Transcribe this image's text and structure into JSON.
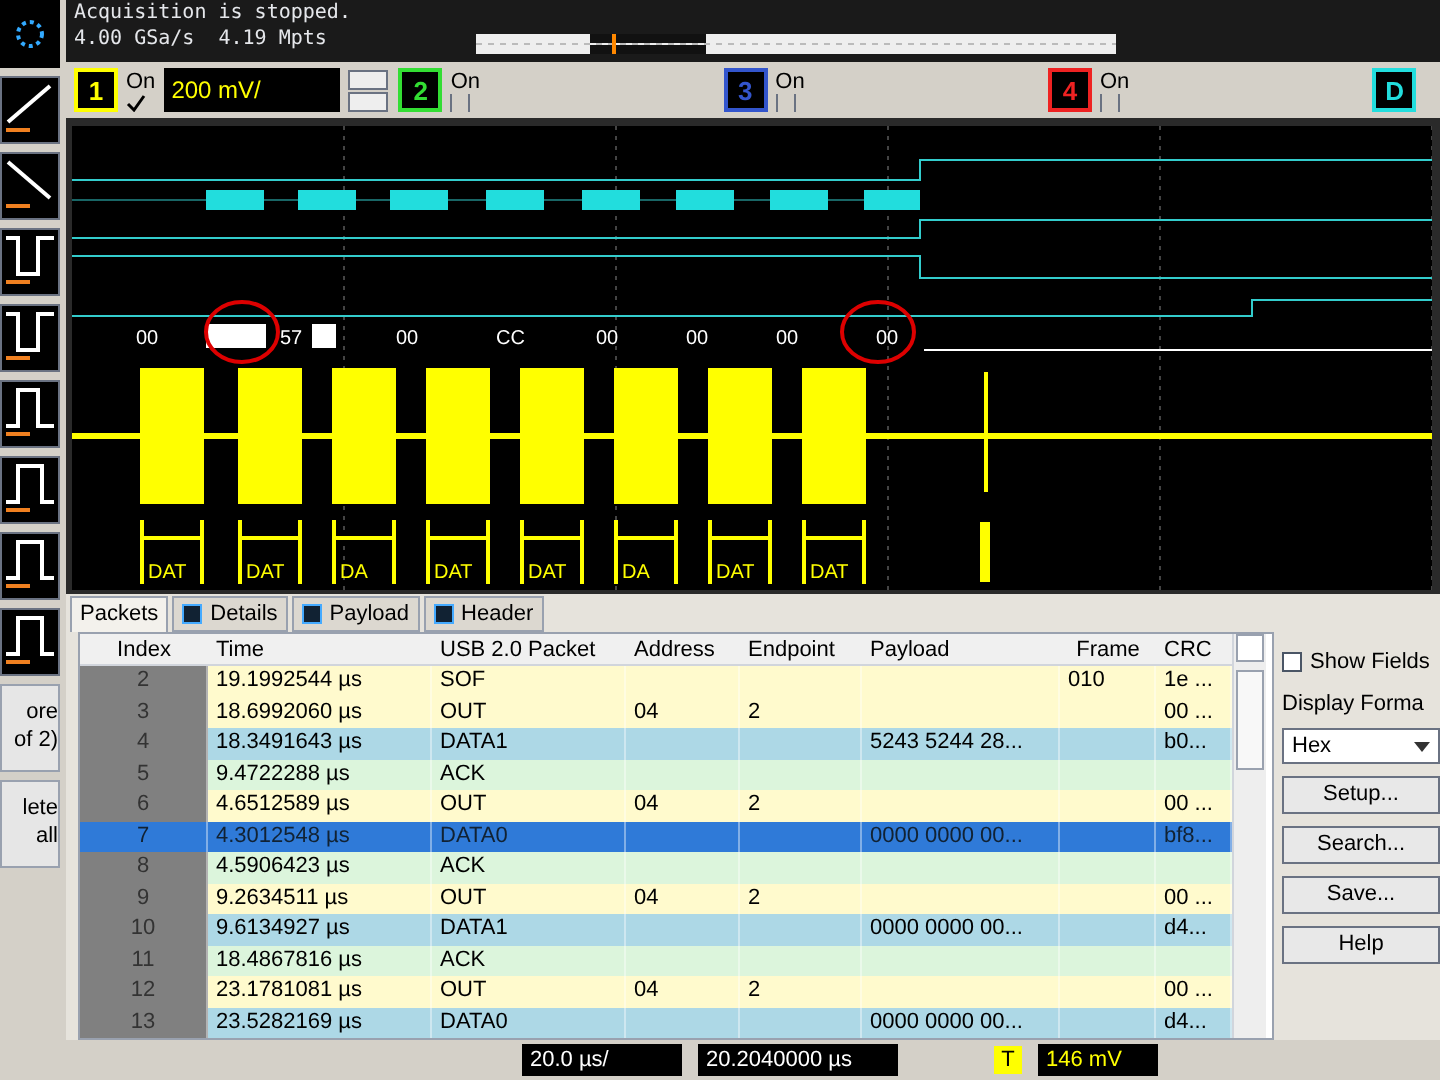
{
  "status": {
    "message": "Acquisition is stopped.",
    "rate": "4.00 GSa/s",
    "points": "4.19 Mpts"
  },
  "channels": [
    {
      "label": "1",
      "color": "#ffff00",
      "state_label": "On",
      "on": true,
      "scale": "200 mV/"
    },
    {
      "label": "2",
      "color": "#33dd33",
      "state_label": "On",
      "on": false
    },
    {
      "label": "3",
      "color": "#3355cc",
      "state_label": "On",
      "on": false
    },
    {
      "label": "4",
      "color": "#ee2222",
      "state_label": "On",
      "on": false
    },
    {
      "label": "D",
      "color": "#22dddd"
    }
  ],
  "bus_labels": [
    "00",
    "57",
    "00",
    "CC",
    "00",
    "00",
    "00",
    "00"
  ],
  "decode_labels": [
    "DAT",
    "DAT",
    "DA",
    "DAT",
    "DAT",
    "DA",
    "DAT",
    "DAT"
  ],
  "sidebar": {
    "more": [
      "ore",
      "of 2)"
    ],
    "delete": [
      "lete",
      "all"
    ]
  },
  "tabs": [
    {
      "label": "Packets",
      "selected": true
    },
    {
      "label": "Details",
      "selected": false
    },
    {
      "label": "Payload",
      "selected": false
    },
    {
      "label": "Header",
      "selected": false
    }
  ],
  "table": {
    "columns": [
      "Index",
      "Time",
      "USB 2.0 Packet",
      "Address",
      "Endpoint",
      "Payload",
      "Frame",
      "CRC"
    ],
    "rows": [
      {
        "kind": "token",
        "selected": false,
        "cells": [
          "2",
          "19.1992544 µs",
          "SOF",
          "",
          "",
          "",
          "010",
          "1e ..."
        ]
      },
      {
        "kind": "token",
        "selected": false,
        "cells": [
          "3",
          "18.6992060 µs",
          "OUT",
          "04",
          "2",
          "",
          "",
          "00 ..."
        ]
      },
      {
        "kind": "data",
        "selected": false,
        "cells": [
          "4",
          "18.3491643 µs",
          "DATA1",
          "",
          "",
          "5243 5244 28...",
          "",
          "b0..."
        ]
      },
      {
        "kind": "handshake",
        "selected": false,
        "cells": [
          "5",
          "9.4722288 µs",
          "ACK",
          "",
          "",
          "",
          "",
          ""
        ]
      },
      {
        "kind": "token",
        "selected": false,
        "cells": [
          "6",
          "4.6512589 µs",
          "OUT",
          "04",
          "2",
          "",
          "",
          "00 ..."
        ]
      },
      {
        "selected": true,
        "cells": [
          "7",
          "4.3012548 µs",
          "DATA0",
          "",
          "",
          "0000 0000 00...",
          "",
          "bf8..."
        ]
      },
      {
        "kind": "handshake",
        "selected": false,
        "cells": [
          "8",
          "4.5906423 µs",
          "ACK",
          "",
          "",
          "",
          "",
          ""
        ]
      },
      {
        "kind": "token",
        "selected": false,
        "cells": [
          "9",
          "9.2634511 µs",
          "OUT",
          "04",
          "2",
          "",
          "",
          "00 ..."
        ]
      },
      {
        "kind": "data",
        "selected": false,
        "cells": [
          "10",
          "9.6134927 µs",
          "DATA1",
          "",
          "",
          "0000 0000 00...",
          "",
          "d4..."
        ]
      },
      {
        "kind": "handshake",
        "selected": false,
        "cells": [
          "11",
          "18.4867816 µs",
          "ACK",
          "",
          "",
          "",
          "",
          ""
        ]
      },
      {
        "kind": "token",
        "selected": false,
        "cells": [
          "12",
          "23.1781081 µs",
          "OUT",
          "04",
          "2",
          "",
          "",
          "00 ..."
        ]
      },
      {
        "kind": "data",
        "selected": false,
        "cells": [
          "13",
          "23.5282169 µs",
          "DATA0",
          "",
          "",
          "0000 0000 00...",
          "",
          "d4..."
        ]
      }
    ]
  },
  "panel": {
    "show_fields": {
      "label": "Show Fields",
      "checked": false
    },
    "format_label": "Display Forma",
    "format": "Hex",
    "buttons": [
      "Setup...",
      "Search...",
      "Save...",
      "Help"
    ]
  },
  "bottom": {
    "timebase": "20.0 µs/",
    "delay": "20.2040000 µs",
    "trigger_label": "T",
    "trigger_level": "146 mV"
  }
}
